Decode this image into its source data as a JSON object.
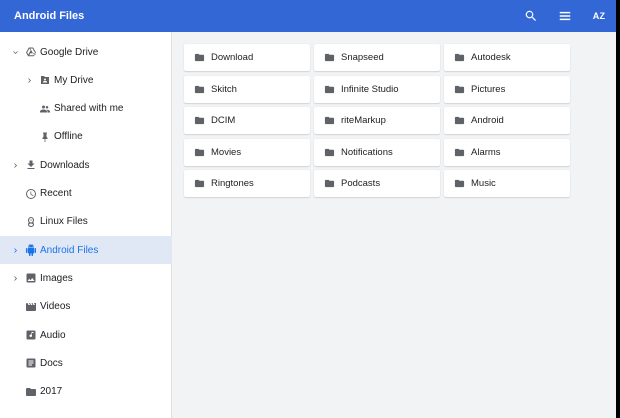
{
  "app": {
    "title": "Android Files"
  },
  "toolbar": {
    "search_icon": "search-icon",
    "view_icon": "list-view-icon",
    "sort_label": "AZ"
  },
  "sidebar": {
    "items": [
      {
        "label": "Google Drive",
        "icon": "drive-icon",
        "chevron": "down",
        "level": 0
      },
      {
        "label": "My Drive",
        "icon": "my-drive-icon",
        "chevron": "right",
        "level": 1
      },
      {
        "label": "Shared with me",
        "icon": "people-icon",
        "chevron": "",
        "level": 1
      },
      {
        "label": "Offline",
        "icon": "pin-icon",
        "chevron": "",
        "level": 1
      },
      {
        "label": "Downloads",
        "icon": "download-icon",
        "chevron": "right",
        "level": 0
      },
      {
        "label": "Recent",
        "icon": "clock-icon",
        "chevron": "",
        "level": 0
      },
      {
        "label": "Linux Files",
        "icon": "penguin-icon",
        "chevron": "",
        "level": 0
      },
      {
        "label": "Android Files",
        "icon": "android-icon",
        "chevron": "right",
        "level": 0,
        "active": true
      },
      {
        "label": "Images",
        "icon": "image-icon",
        "chevron": "right",
        "level": 0
      },
      {
        "label": "Videos",
        "icon": "video-icon",
        "chevron": "",
        "level": 0
      },
      {
        "label": "Audio",
        "icon": "audio-icon",
        "chevron": "",
        "level": 0
      },
      {
        "label": "Docs",
        "icon": "docs-icon",
        "chevron": "",
        "level": 0
      },
      {
        "label": "2017",
        "icon": "folder-icon",
        "chevron": "",
        "level": 0
      }
    ]
  },
  "folders": [
    "Download",
    "Snapseed",
    "Autodesk",
    "Skitch",
    "Infinite Studio",
    "Pictures",
    "DCIM",
    "riteMarkup",
    "Android",
    "Movies",
    "Notifications",
    "Alarms",
    "Ringtones",
    "Podcasts",
    "Music"
  ],
  "colors": {
    "header": "#3367d6",
    "active_bg": "#e1e8f5",
    "active_text": "#1a73e8"
  }
}
